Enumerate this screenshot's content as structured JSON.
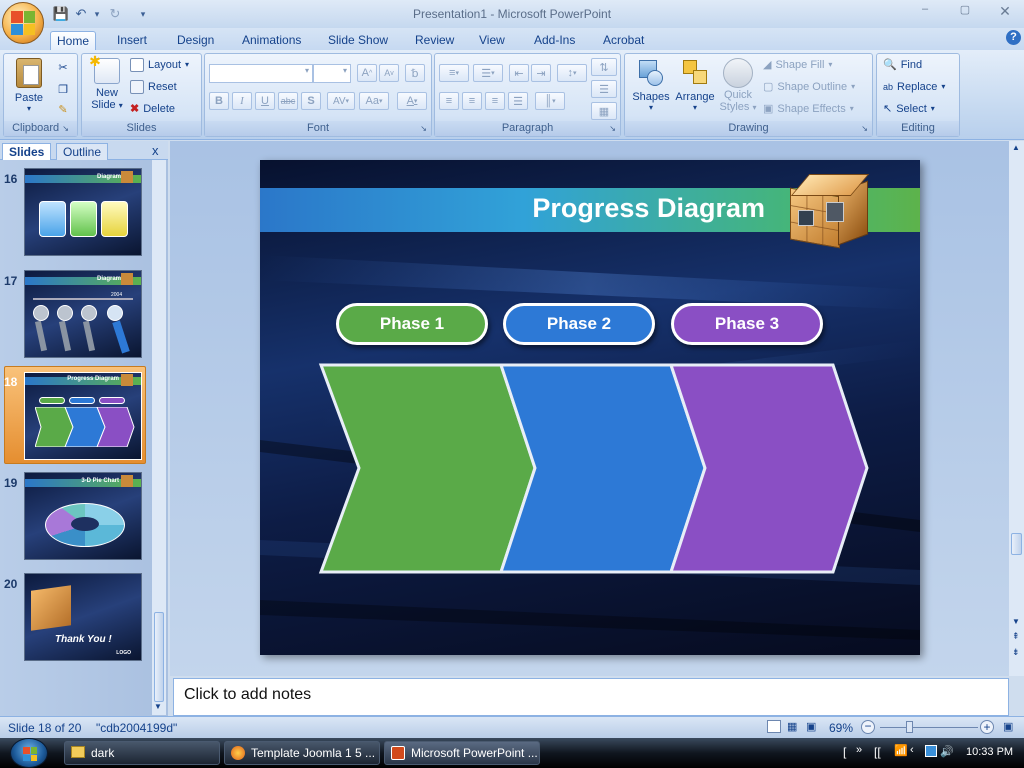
{
  "window": {
    "title": "Presentation1 - Microsoft PowerPoint"
  },
  "qat": {
    "save": "save-icon",
    "undo": "undo-icon",
    "redo": "redo-icon",
    "customize": "▾"
  },
  "tabs": [
    "Home",
    "Insert",
    "Design",
    "Animations",
    "Slide Show",
    "Review",
    "View",
    "Add-Ins",
    "Acrobat"
  ],
  "ribbon": {
    "clipboard": {
      "label": "Clipboard",
      "paste": "Paste"
    },
    "slides": {
      "label": "Slides",
      "new_slide": "New",
      "new_slide2": "Slide",
      "layout": "Layout",
      "reset": "Reset",
      "delete": "Delete"
    },
    "font": {
      "label": "Font",
      "bold": "B",
      "italic": "I",
      "underline": "U",
      "strike": "abc",
      "shadow": "S",
      "spacing": "AV",
      "case": "Aa",
      "color": "A",
      "grow": "A",
      "shrink": "A"
    },
    "paragraph": {
      "label": "Paragraph"
    },
    "drawing": {
      "label": "Drawing",
      "shapes": "Shapes",
      "arrange": "Arrange",
      "quick_styles": "Quick",
      "quick_styles2": "Styles",
      "shape_fill": "Shape Fill",
      "shape_outline": "Shape Outline",
      "shape_effects": "Shape Effects"
    },
    "editing": {
      "label": "Editing",
      "find": "Find",
      "replace": "Replace",
      "select": "Select"
    }
  },
  "pane": {
    "tab_slides": "Slides",
    "tab_outline": "Outline",
    "close": "x"
  },
  "thumbnails": [
    {
      "num": "16",
      "title": "Diagram"
    },
    {
      "num": "17",
      "title": "Diagram"
    },
    {
      "num": "18",
      "title": "Progress Diagram"
    },
    {
      "num": "19",
      "title": "3-D Pie Chart"
    },
    {
      "num": "20",
      "title": "Thank You !"
    }
  ],
  "thumb17_year": "2004",
  "thumb20_logo": "LOGO",
  "slide": {
    "title": "Progress Diagram",
    "phases": [
      "Phase 1",
      "Phase 2",
      "Phase 3"
    ],
    "colors": {
      "phase1": "#5aaa48",
      "phase2": "#2d79d6",
      "phase3": "#8a4fc4"
    }
  },
  "notes": {
    "placeholder": "Click to add notes"
  },
  "status": {
    "slide": "Slide 18 of 20",
    "theme": "\"cdb2004199d\"",
    "zoom": "69%"
  },
  "taskbar": {
    "items": [
      "dark",
      "Template Joomla 1 5 ...",
      "Microsoft PowerPoint ..."
    ],
    "clock": "10:33 PM"
  }
}
